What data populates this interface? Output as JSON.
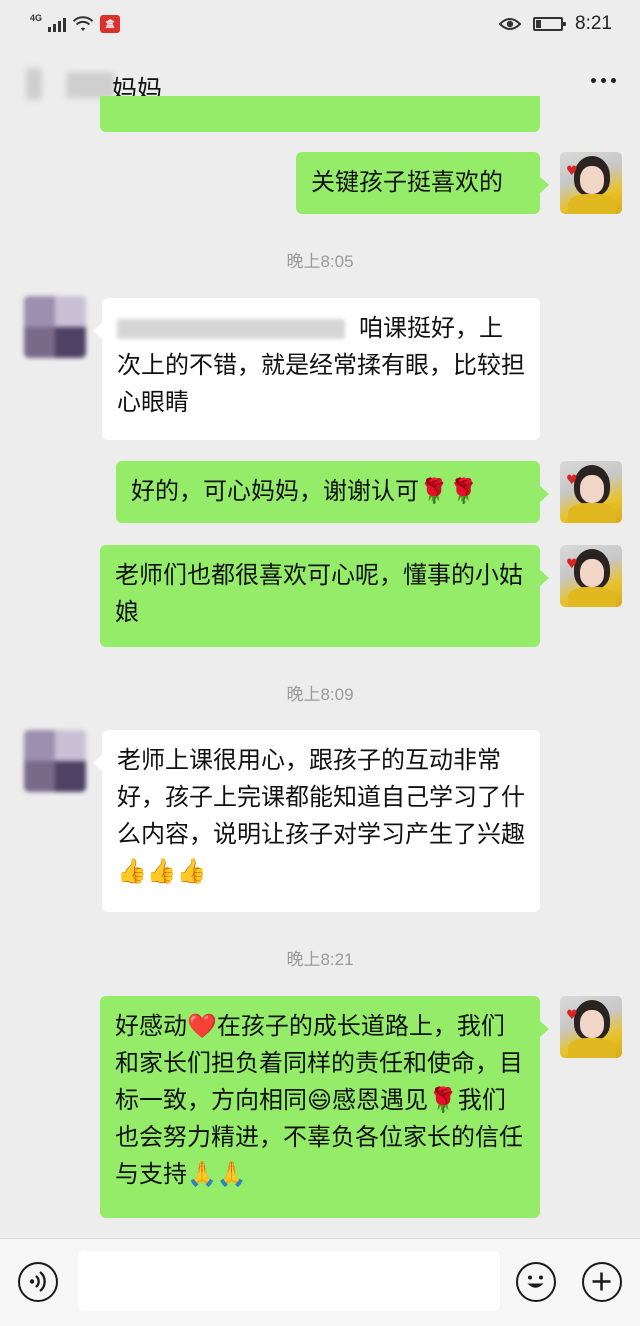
{
  "status_bar": {
    "network": "4G",
    "app_badge": "HEMA",
    "clock": "8:21",
    "battery_level": 0.2
  },
  "header": {
    "title": "妈妈",
    "more_icon": "more-dots-icon"
  },
  "messages": [
    {
      "id": "m1",
      "side": "out",
      "text": "关键孩子挺喜欢的"
    },
    {
      "id": "t1",
      "type": "time",
      "text": "晚上8:05"
    },
    {
      "id": "m2",
      "side": "in",
      "text": "咱课挺好，上次上的不错，就是经常揉有眼，比较担心眼睛"
    },
    {
      "id": "m3",
      "side": "out",
      "text": "好的，可心妈妈，谢谢认可🌹🌹"
    },
    {
      "id": "m4",
      "side": "out",
      "text": "老师们也都很喜欢可心呢，懂事的小姑娘"
    },
    {
      "id": "t2",
      "type": "time",
      "text": "晚上8:09"
    },
    {
      "id": "m5",
      "side": "in",
      "text": "老师上课很用心，跟孩子的互动非常好，孩子上完课都能知道自己学习了什么内容，说明让孩子对学习产生了兴趣👍👍👍"
    },
    {
      "id": "t3",
      "type": "time",
      "text": "晚上8:21"
    },
    {
      "id": "m6",
      "side": "out",
      "text": "好感动❤️在孩子的成长道路上，我们和家长们担负着同样的责任和使命，目标一致，方向相同😄感恩遇见🌹我们也会努力精进，不辜负各位家长的信任与支持🙏🙏"
    }
  ],
  "m2_text": "咱课挺好，上次上的不错，就是经常揉有眼，比较担心眼睛",
  "input_bar": {
    "voice_icon": "voice-icon",
    "emoji_icon": "emoji-icon",
    "plus_icon": "plus-icon",
    "placeholder": ""
  }
}
